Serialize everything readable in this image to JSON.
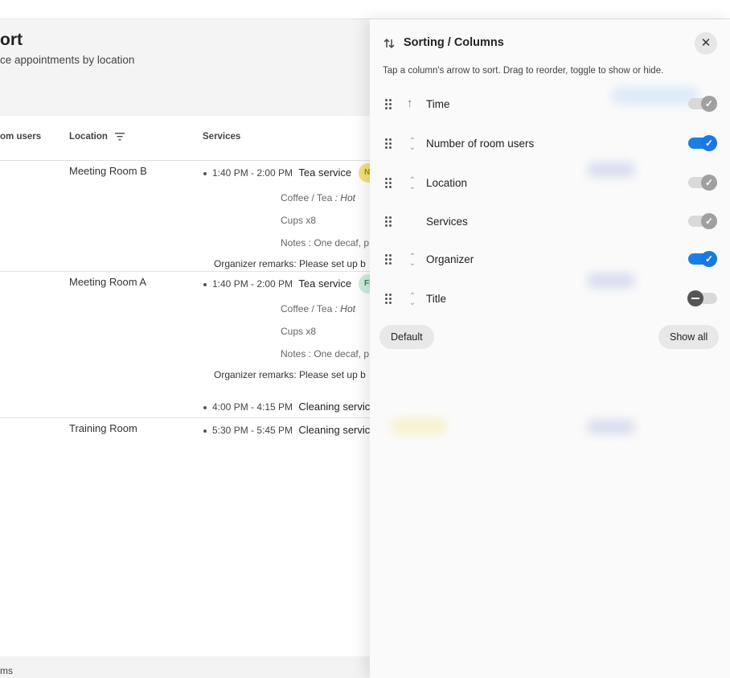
{
  "page": {
    "title": "ort",
    "subtitle": "ce appointments by location",
    "columns": {
      "room_users": "om users",
      "location": "Location",
      "services": "Services"
    },
    "rows": [
      {
        "location": "Meeting Room B",
        "services": [
          {
            "time": "1:40 PM - 2:00 PM",
            "name": "Tea service",
            "chip": "N"
          }
        ],
        "details": [
          {
            "text": "Coffee / Tea",
            "suffix": " : Hot"
          },
          {
            "text": "Cups x8",
            "suffix": ""
          },
          {
            "text": "Notes : One decaf, p",
            "suffix": ""
          }
        ],
        "remark": "Organizer remarks: Please set up b"
      },
      {
        "location": "Meeting Room A",
        "services": [
          {
            "time": "1:40 PM - 2:00 PM",
            "name": "Tea service",
            "chip": "Fl"
          },
          {
            "time": "4:00 PM - 4:15 PM",
            "name": "Cleaning servic",
            "chip": ""
          }
        ],
        "details": [
          {
            "text": "Coffee / Tea",
            "suffix": " : Hot"
          },
          {
            "text": "Cups x8",
            "suffix": ""
          },
          {
            "text": "Notes : One decaf, p",
            "suffix": ""
          }
        ],
        "remark": "Organizer remarks: Please set up b"
      },
      {
        "location": "Training Room",
        "services": [
          {
            "time": "5:30 PM - 5:45 PM",
            "name": "Cleaning servic",
            "chip": ""
          }
        ]
      }
    ],
    "footer": "ms"
  },
  "panel": {
    "title": "Sorting / Columns",
    "hint": "Tap a column's arrow to sort. Drag to reorder, toggle to show or hide.",
    "close_icon": "close-icon",
    "columns": [
      {
        "label": "Time",
        "sort": "ascending",
        "state": "locked"
      },
      {
        "label": "Number of room users",
        "sort": "none",
        "state": "on"
      },
      {
        "label": "Location",
        "sort": "none",
        "state": "locked"
      },
      {
        "label": "Services",
        "sort": "unsortable",
        "state": "locked"
      },
      {
        "label": "Organizer",
        "sort": "none",
        "state": "on"
      },
      {
        "label": "Title",
        "sort": "none",
        "state": "off"
      }
    ],
    "default_label": "Default",
    "show_all_label": "Show all"
  },
  "colors": {
    "accent": "#1c7fe8",
    "sort_active": "#2ca86a",
    "chip_yellow": "#f7e27a",
    "chip_green": "#cfeedd"
  }
}
